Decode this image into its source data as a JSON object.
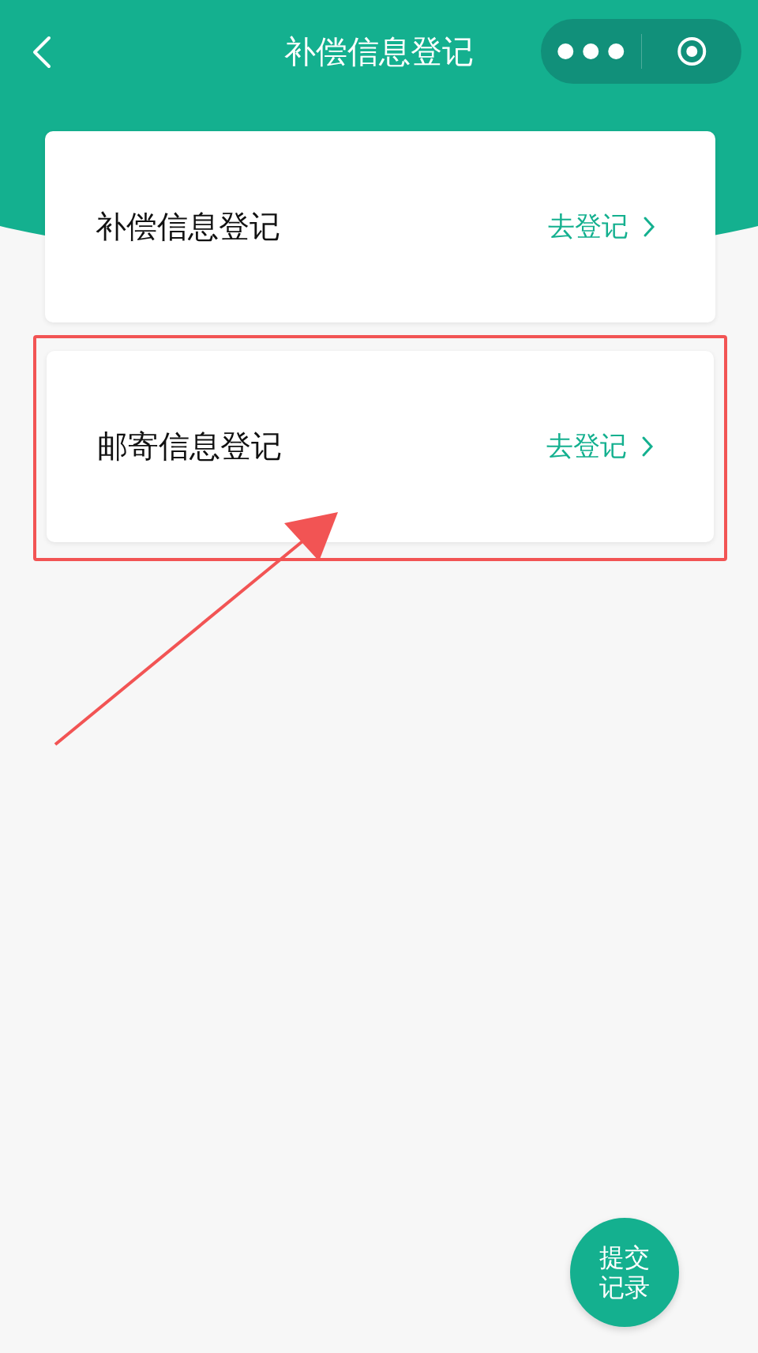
{
  "nav": {
    "title": "补偿信息登记"
  },
  "entries": [
    {
      "title": "补偿信息登记",
      "action": "去登记",
      "highlighted": false
    },
    {
      "title": "邮寄信息登记",
      "action": "去登记",
      "highlighted": true
    }
  ],
  "float_button": {
    "label": "提交记录"
  }
}
